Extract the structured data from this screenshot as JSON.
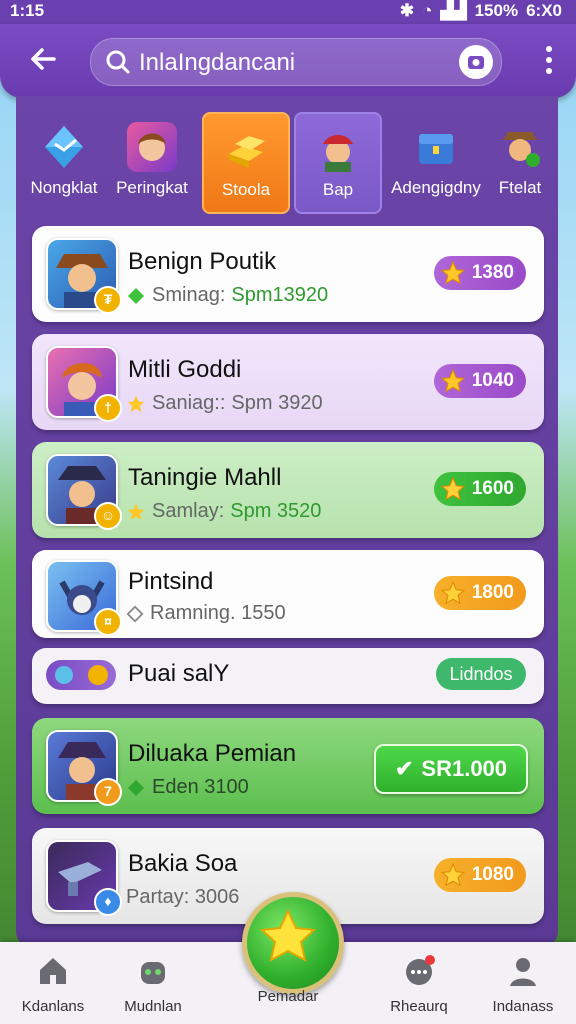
{
  "status": {
    "time": "1:15",
    "battery": "150%",
    "extra": "6:X0"
  },
  "search": {
    "value": "InlaIngdancani"
  },
  "categories": [
    {
      "label": "Nongklat"
    },
    {
      "label": "Peringkat"
    },
    {
      "label": "Stoola"
    },
    {
      "label": "Bap"
    },
    {
      "label": "Adengigdny"
    },
    {
      "label": "Ftelat"
    }
  ],
  "rows": [
    {
      "name": "Benign Poutik",
      "sub_prefix": "Sminag: ",
      "sub_value": "Spm13920",
      "value": "1380"
    },
    {
      "name": "Mitli Goddi",
      "sub_prefix": "Saniag:: ",
      "sub_value": "Spm 3920",
      "value": "1040"
    },
    {
      "name": "Taningie Mahll",
      "sub_prefix": "Samlay: ",
      "sub_value": "Spm 3520",
      "value": "1600"
    },
    {
      "name": "Pintsind",
      "sub_prefix": "",
      "sub_value": "Ramning. 1550",
      "value": "1800"
    },
    {
      "name": "Puai salY",
      "button": "Lidndos"
    },
    {
      "name": "Diluaka Pemian",
      "sub_prefix": "",
      "sub_value": "Eden 3100",
      "button": "SR1.000"
    },
    {
      "name": "Bakia Soa",
      "sub_prefix": "",
      "sub_value": "Partay: 3006",
      "value": "1080"
    }
  ],
  "nav": [
    {
      "label": "Kdanlans"
    },
    {
      "label": "Mudnlan"
    },
    {
      "label": "Pemadar"
    },
    {
      "label": "Rheaurq"
    },
    {
      "label": "Indanass"
    }
  ],
  "colors": {
    "purple": "#6a3aae",
    "orange": "#f29a1c",
    "green": "#3ec23e",
    "pill_purple": "#9a4ac8"
  }
}
